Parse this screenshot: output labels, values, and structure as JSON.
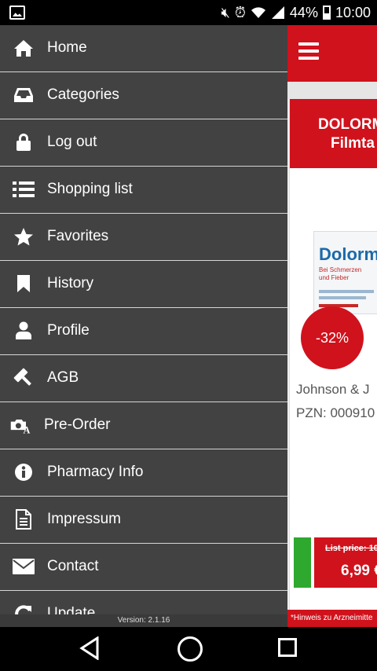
{
  "status_bar": {
    "battery": "44%",
    "time": "10:00",
    "icons": [
      "gallery-icon",
      "mute-icon",
      "alarm-icon",
      "wifi-icon",
      "signal-icon",
      "battery-icon"
    ]
  },
  "drawer": {
    "items": [
      {
        "label": "Home",
        "icon": "home-icon"
      },
      {
        "label": "Categories",
        "icon": "inbox-icon"
      },
      {
        "label": "Log out",
        "icon": "lock-icon"
      },
      {
        "label": "Shopping list",
        "icon": "list-icon"
      },
      {
        "label": "Favorites",
        "icon": "star-icon"
      },
      {
        "label": "History",
        "icon": "bookmark-icon"
      },
      {
        "label": "Profile",
        "icon": "user-icon"
      },
      {
        "label": "AGB",
        "icon": "gavel-icon"
      },
      {
        "label": "Pre-Order",
        "icon": "camera-text-icon"
      },
      {
        "label": "Pharmacy Info",
        "icon": "info-icon"
      },
      {
        "label": "Impressum",
        "icon": "document-icon"
      },
      {
        "label": "Contact",
        "icon": "envelope-icon"
      },
      {
        "label": "Update",
        "icon": "refresh-icon"
      }
    ],
    "version": "Version: 2.1.16"
  },
  "app": {
    "card_title_line1": "DOLORM",
    "card_title_line2": "Filmta",
    "product_brand": "Dolorm",
    "product_sub1": "Bei Schmerzen",
    "product_sub2": "und Fieber",
    "discount": "-32%",
    "manufacturer": "Johnson & J",
    "pzn": "PZN: 000910",
    "list_price": "List price: 10",
    "price": "6,99 €",
    "hint": "*Hinweis zu Arzneimitte",
    "accent_color": "#d0121c"
  }
}
